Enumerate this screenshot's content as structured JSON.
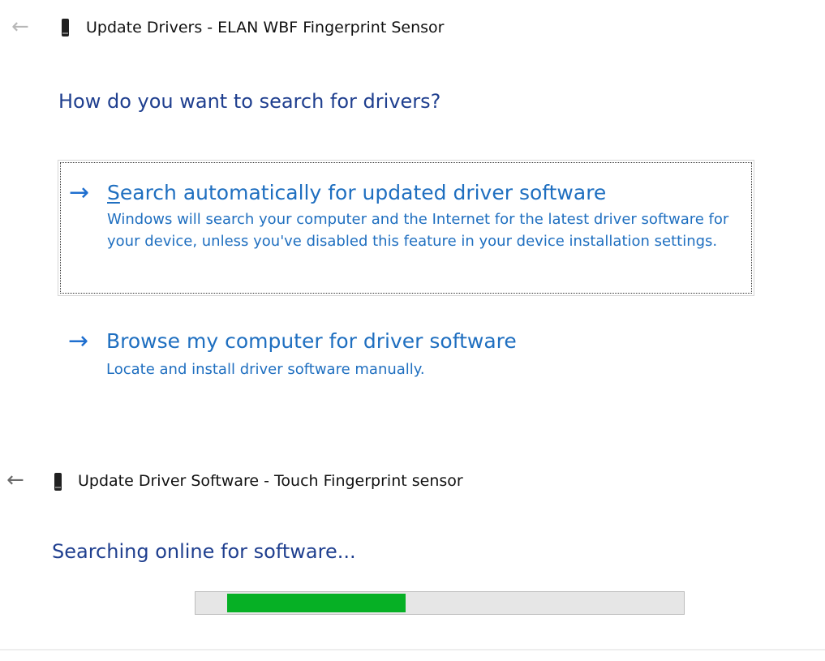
{
  "dialog1": {
    "back_icon": "left-arrow-icon",
    "device_icon": "fingerprint-device-icon",
    "title": "Update Drivers - ELAN WBF Fingerprint Sensor",
    "heading": "How do you want to search for drivers?",
    "options": [
      {
        "icon": "right-arrow-icon",
        "title_accel": "S",
        "title_rest": "earch automatically for updated driver software",
        "description": "Windows will search your computer and the Internet for the latest driver software for your device, unless you've disabled this feature in your device installation settings."
      },
      {
        "icon": "right-arrow-icon",
        "title": "Browse my computer for driver software",
        "description": "Locate and install driver software manually."
      }
    ]
  },
  "dialog2": {
    "back_icon": "left-arrow-icon",
    "device_icon": "fingerprint-device-icon",
    "title": "Update Driver Software - Touch Fingerprint sensor",
    "status": "Searching online for software...",
    "progress": {
      "indeterminate": true,
      "fill_color": "#06b025",
      "segment_start_fraction": 0.064,
      "segment_end_fraction": 0.43
    }
  },
  "colors": {
    "heading": "#1f3f8f",
    "link": "#1f6fc0",
    "progress": "#06b025"
  }
}
